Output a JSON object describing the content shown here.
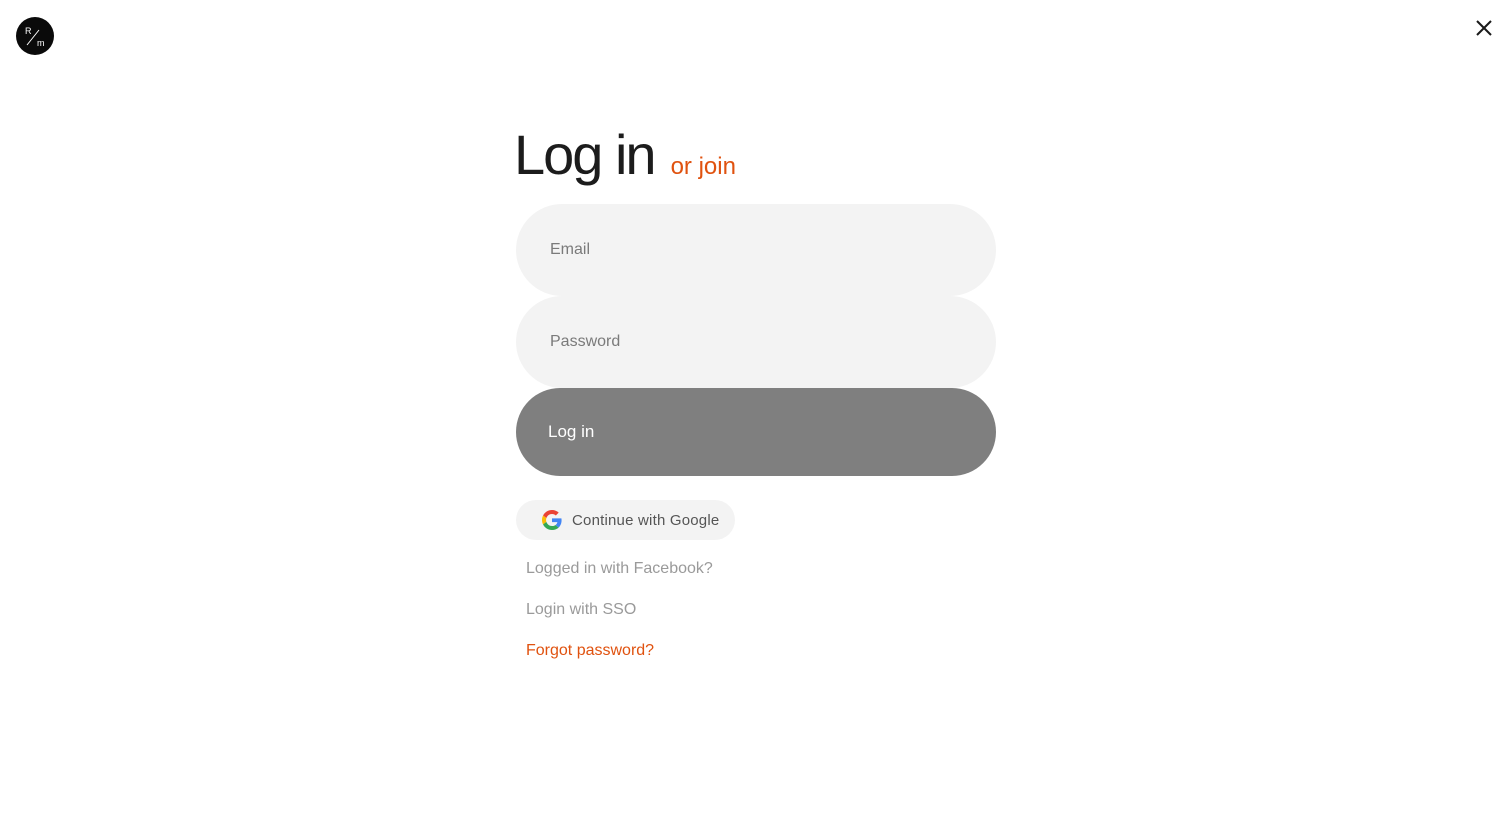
{
  "brand": {
    "logo_top": "R",
    "logo_bottom": "m",
    "accent_color": "#e0520f"
  },
  "header": {
    "close_icon": "close-icon"
  },
  "form": {
    "title": "Log in",
    "join_link": "or join",
    "email_placeholder": "Email",
    "password_placeholder": "Password",
    "submit_label": "Log in",
    "submit_color": "#7f7f7f",
    "google_label": "Continue with Google",
    "google_icon": "google-icon"
  },
  "links": {
    "facebook": "Logged in with Facebook?",
    "sso": "Login with SSO",
    "forgot": "Forgot password?"
  }
}
